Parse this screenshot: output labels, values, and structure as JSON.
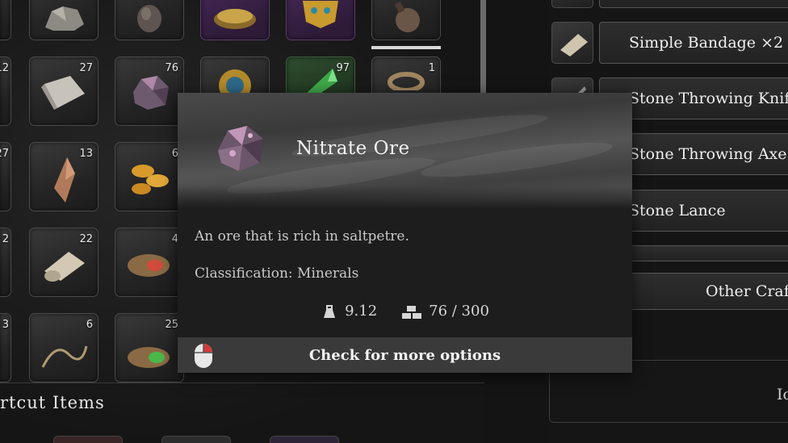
{
  "inventory": {
    "slot_quantities": [
      "12",
      "27",
      "76",
      "97",
      "1",
      "27",
      "13",
      "6",
      "2",
      "22",
      "4",
      "3",
      "6",
      "25"
    ]
  },
  "shortcut": {
    "title": "rtcut Items"
  },
  "crafting": {
    "items": [
      "Simple Bandage ×2",
      "Stone Throwing Knife",
      "Stone Throwing Axe",
      "Stone Lance"
    ],
    "other_label": "Other Craf",
    "action_label": "Io"
  },
  "tooltip": {
    "title": "Nitrate Ore",
    "description": "An ore that is rich in saltpetre.",
    "classification": "Classification: Minerals",
    "weight": "9.12",
    "stack": "76 / 300",
    "footer_label": "Check for more options",
    "icons": [
      "nitrate-ore-icon",
      "weight-icon",
      "stack-icon",
      "mouse-icon"
    ]
  },
  "colors": {
    "footer_bg": "#3a3a3a",
    "mouse_accent": "#d23a3a"
  }
}
